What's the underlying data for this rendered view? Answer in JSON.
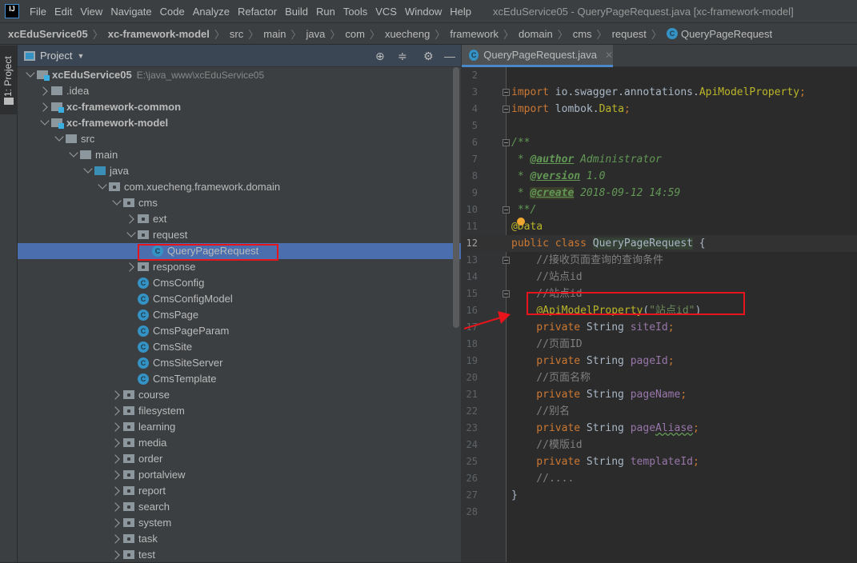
{
  "menubar": {
    "items": [
      "File",
      "Edit",
      "View",
      "Navigate",
      "Code",
      "Analyze",
      "Refactor",
      "Build",
      "Run",
      "Tools",
      "VCS",
      "Window",
      "Help"
    ],
    "window_title": "xcEduService05 - QueryPageRequest.java [xc-framework-model]"
  },
  "breadcrumb": {
    "items": [
      "xcEduService05",
      "xc-framework-model",
      "src",
      "main",
      "java",
      "com",
      "xuecheng",
      "framework",
      "domain",
      "cms",
      "request"
    ],
    "current": "QueryPageRequest"
  },
  "sidestrip": {
    "label": "1: Project"
  },
  "project": {
    "title": "Project",
    "tree": [
      {
        "label": "xcEduService05",
        "path": "E:\\java_www\\xcEduService05",
        "level": 0,
        "type": "module",
        "state": "open",
        "bold": true
      },
      {
        "label": ".idea",
        "level": 1,
        "type": "folder",
        "state": "closed"
      },
      {
        "label": "xc-framework-common",
        "level": 1,
        "type": "module",
        "state": "closed",
        "bold": true
      },
      {
        "label": "xc-framework-model",
        "level": 1,
        "type": "module",
        "state": "open",
        "bold": true
      },
      {
        "label": "src",
        "level": 2,
        "type": "folder",
        "state": "open"
      },
      {
        "label": "main",
        "level": 3,
        "type": "folder",
        "state": "open"
      },
      {
        "label": "java",
        "level": 4,
        "type": "src",
        "state": "open"
      },
      {
        "label": "com.xuecheng.framework.domain",
        "level": 5,
        "type": "package",
        "state": "open"
      },
      {
        "label": "cms",
        "level": 6,
        "type": "package",
        "state": "open"
      },
      {
        "label": "ext",
        "level": 7,
        "type": "package",
        "state": "closed"
      },
      {
        "label": "request",
        "level": 7,
        "type": "package",
        "state": "open"
      },
      {
        "label": "QueryPageRequest",
        "level": 8,
        "type": "class",
        "selected": true
      },
      {
        "label": "response",
        "level": 7,
        "type": "package",
        "state": "closed"
      },
      {
        "label": "CmsConfig",
        "level": 7,
        "type": "class"
      },
      {
        "label": "CmsConfigModel",
        "level": 7,
        "type": "class"
      },
      {
        "label": "CmsPage",
        "level": 7,
        "type": "class"
      },
      {
        "label": "CmsPageParam",
        "level": 7,
        "type": "class"
      },
      {
        "label": "CmsSite",
        "level": 7,
        "type": "class"
      },
      {
        "label": "CmsSiteServer",
        "level": 7,
        "type": "class"
      },
      {
        "label": "CmsTemplate",
        "level": 7,
        "type": "class"
      },
      {
        "label": "course",
        "level": 6,
        "type": "package",
        "state": "closed"
      },
      {
        "label": "filesystem",
        "level": 6,
        "type": "package",
        "state": "closed"
      },
      {
        "label": "learning",
        "level": 6,
        "type": "package",
        "state": "closed"
      },
      {
        "label": "media",
        "level": 6,
        "type": "package",
        "state": "closed"
      },
      {
        "label": "order",
        "level": 6,
        "type": "package",
        "state": "closed"
      },
      {
        "label": "portalview",
        "level": 6,
        "type": "package",
        "state": "closed"
      },
      {
        "label": "report",
        "level": 6,
        "type": "package",
        "state": "closed"
      },
      {
        "label": "search",
        "level": 6,
        "type": "package",
        "state": "closed"
      },
      {
        "label": "system",
        "level": 6,
        "type": "package",
        "state": "closed"
      },
      {
        "label": "task",
        "level": 6,
        "type": "package",
        "state": "closed"
      },
      {
        "label": "test",
        "level": 6,
        "type": "package",
        "state": "closed"
      }
    ]
  },
  "editor": {
    "tab": {
      "label": "QueryPageRequest.java",
      "icon": "C"
    },
    "current_line": 12,
    "lines": [
      {
        "n": "2",
        "t": []
      },
      {
        "n": "3",
        "fold": true,
        "t": [
          [
            "kw",
            "import "
          ],
          [
            "pl",
            "io.swagger.annotations."
          ],
          [
            "an",
            "ApiModelProperty"
          ],
          [
            "kw",
            ";"
          ]
        ]
      },
      {
        "n": "4",
        "fold": true,
        "t": [
          [
            "kw",
            "import "
          ],
          [
            "pl",
            "lombok."
          ],
          [
            "an",
            "Data"
          ],
          [
            "kw",
            ";"
          ]
        ]
      },
      {
        "n": "5",
        "t": []
      },
      {
        "n": "6",
        "fold": true,
        "t": [
          [
            "jd",
            "/**"
          ]
        ]
      },
      {
        "n": "7",
        "t": [
          [
            "jd",
            " * "
          ],
          [
            "jt",
            "@author"
          ],
          [
            "jd",
            " Administrator"
          ]
        ]
      },
      {
        "n": "8",
        "t": [
          [
            "jd",
            " * "
          ],
          [
            "jt",
            "@version"
          ],
          [
            "jd",
            " 1.0"
          ]
        ]
      },
      {
        "n": "9",
        "t": [
          [
            "jd",
            " * "
          ],
          [
            "jth",
            "@create"
          ],
          [
            "jd",
            " 2018-09-12 14:59"
          ]
        ]
      },
      {
        "n": "10",
        "fold": true,
        "t": [
          [
            "jd",
            " **/"
          ]
        ]
      },
      {
        "n": "11",
        "t": [
          [
            "an",
            "@Data"
          ]
        ]
      },
      {
        "n": "12",
        "t": [
          [
            "kw",
            "public class "
          ],
          [
            "cn",
            "QueryPageRequest"
          ],
          [
            "pl",
            " {"
          ]
        ]
      },
      {
        "n": "13",
        "fold": true,
        "t": [
          [
            "cm",
            "    //接收页面查询的查询条件"
          ]
        ]
      },
      {
        "n": "14",
        "t": [
          [
            "cm",
            "    //站点id"
          ]
        ]
      },
      {
        "n": "15",
        "fold": true,
        "t": [
          [
            "cm",
            "    //站点id"
          ]
        ]
      },
      {
        "n": "16",
        "t": [
          [
            "pl",
            "    "
          ],
          [
            "an",
            "@ApiModelProperty"
          ],
          [
            "pl",
            "("
          ],
          [
            "st",
            "\"站点id\""
          ],
          [
            "pl",
            ")"
          ]
        ]
      },
      {
        "n": "17",
        "t": [
          [
            "kw",
            "    private "
          ],
          [
            "pl",
            "String "
          ],
          [
            "fd",
            "siteId"
          ],
          [
            "kw",
            ";"
          ]
        ]
      },
      {
        "n": "18",
        "t": [
          [
            "cm",
            "    //页面ID"
          ]
        ]
      },
      {
        "n": "19",
        "t": [
          [
            "kw",
            "    private "
          ],
          [
            "pl",
            "String "
          ],
          [
            "fd",
            "pageId"
          ],
          [
            "kw",
            ";"
          ]
        ]
      },
      {
        "n": "20",
        "t": [
          [
            "cm",
            "    //页面名称"
          ]
        ]
      },
      {
        "n": "21",
        "t": [
          [
            "kw",
            "    private "
          ],
          [
            "pl",
            "String "
          ],
          [
            "fd",
            "pageName"
          ],
          [
            "kw",
            ";"
          ]
        ]
      },
      {
        "n": "22",
        "t": [
          [
            "cm",
            "    //别名"
          ]
        ]
      },
      {
        "n": "23",
        "t": [
          [
            "kw",
            "    private "
          ],
          [
            "pl",
            "String "
          ],
          [
            "fd",
            "page"
          ],
          [
            "wv",
            "Aliase"
          ],
          [
            "kw",
            ";"
          ]
        ]
      },
      {
        "n": "24",
        "t": [
          [
            "cm",
            "    //模版id"
          ]
        ]
      },
      {
        "n": "25",
        "t": [
          [
            "kw",
            "    private "
          ],
          [
            "pl",
            "String "
          ],
          [
            "fd",
            "templateId"
          ],
          [
            "kw",
            ";"
          ]
        ]
      },
      {
        "n": "26",
        "t": [
          [
            "cm",
            "    //...."
          ]
        ]
      },
      {
        "n": "27",
        "t": [
          [
            "pl",
            "}"
          ]
        ]
      },
      {
        "n": "28",
        "t": []
      }
    ]
  },
  "colors": {
    "selection": "#4b6eaf",
    "highlight_box": "#e8141b",
    "keyword": "#cc7832",
    "annotation": "#bbb529",
    "comment": "#808080"
  }
}
